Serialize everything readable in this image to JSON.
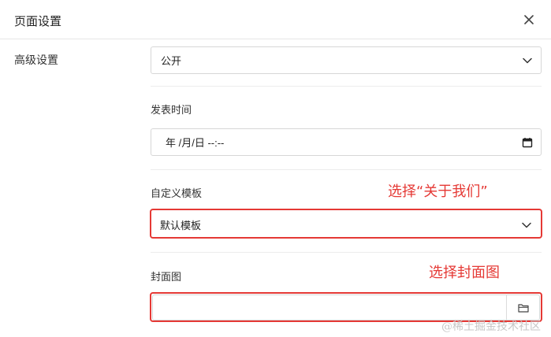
{
  "dialog": {
    "title": "页面设置"
  },
  "sidebar": {
    "section_label": "高级设置"
  },
  "form": {
    "visibility": {
      "value": "公开"
    },
    "publish_time": {
      "label": "发表时间",
      "placeholder": "年 /月/日 --:--"
    },
    "template": {
      "label": "自定义模板",
      "value": "默认模板"
    },
    "cover": {
      "label": "封面图"
    }
  },
  "annotations": {
    "template_hint": "选择“关于我们”",
    "cover_hint": "选择封面图",
    "color": "#e53935"
  },
  "watermark": "@稀土掘金技术社区"
}
